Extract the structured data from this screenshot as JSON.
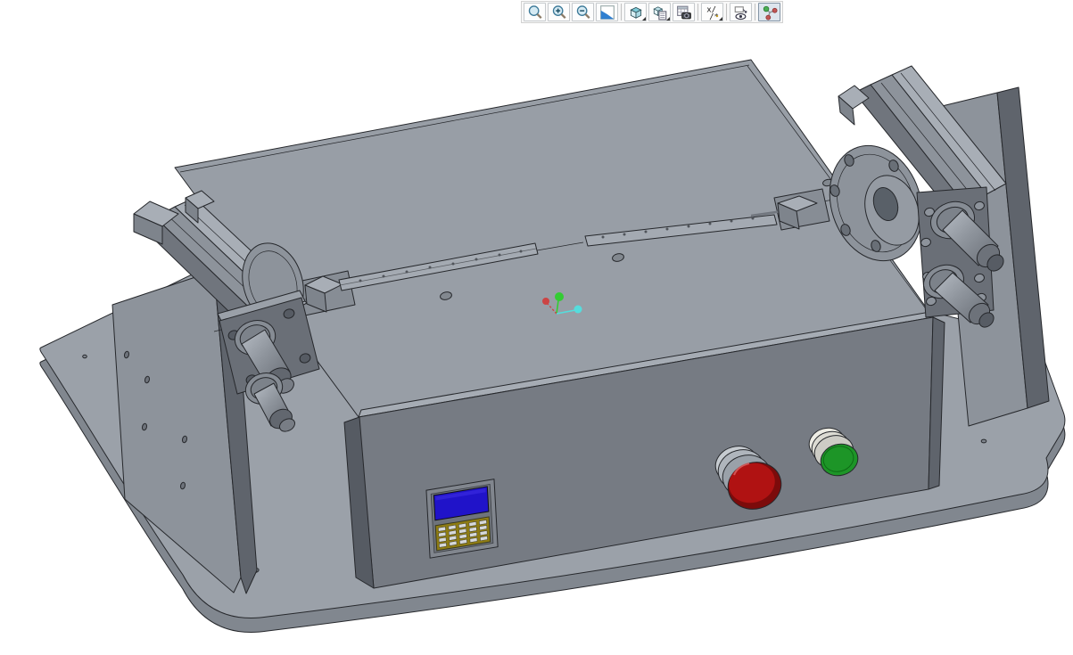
{
  "window": {
    "type": "cad-application-viewport",
    "background": "#ffffff"
  },
  "toolbar": {
    "position": "top-center",
    "buttons": [
      {
        "name": "refit",
        "icon": "magnifier-icon",
        "active": false,
        "dropdown": false,
        "group_end": false
      },
      {
        "name": "zoom-in",
        "icon": "magnifier-plus-icon",
        "active": false,
        "dropdown": false,
        "group_end": false
      },
      {
        "name": "zoom-out",
        "icon": "magnifier-minus-icon",
        "active": false,
        "dropdown": false,
        "group_end": false
      },
      {
        "name": "repaint",
        "icon": "repaint-icon",
        "active": false,
        "dropdown": false,
        "group_end": true
      },
      {
        "name": "display-style",
        "icon": "cube-icon",
        "active": false,
        "dropdown": true,
        "group_end": false
      },
      {
        "name": "saved-orientations",
        "icon": "cube-page-icon",
        "active": false,
        "dropdown": true,
        "group_end": false
      },
      {
        "name": "capture-image",
        "icon": "table-camera-icon",
        "active": false,
        "dropdown": false,
        "group_end": true
      },
      {
        "name": "datum-display-filters",
        "icon": "datum-filters-icon",
        "active": false,
        "dropdown": true,
        "group_end": true
      },
      {
        "name": "annotation-display",
        "icon": "annotation-eye-icon",
        "active": false,
        "dropdown": false,
        "group_end": true
      },
      {
        "name": "spin-center",
        "icon": "spin-center-icon",
        "active": true,
        "dropdown": false,
        "group_end": false
      }
    ]
  },
  "viewport": {
    "content": "3D CAD assembly - clamping fixture on rounded base plate",
    "spin_center": {
      "visible": true,
      "axis_colors": {
        "vertical": "#33cc33",
        "left": "#cc4444",
        "right": "#55dddd"
      }
    },
    "model_parts": [
      "base-plate",
      "left-upright-plate",
      "right-upright-plate",
      "left-clamp-unit",
      "right-clamp-unit",
      "rotary-flange",
      "main-housing",
      "top-guide-rails",
      "control-panel",
      "lcd-display",
      "keypad",
      "red-emergency-button",
      "green-start-button"
    ]
  },
  "theme": {
    "canvas_bg": "#ffffff",
    "edge": "#26282c",
    "metal_top": "#989ea6",
    "metal_front": "#767b83",
    "metal_side": "#5f646c",
    "red_button": "#b01212",
    "red_button_rim": "#7c0b0b",
    "green_button": "#1d9527",
    "lcd_blue": "#2013c9",
    "keypad_gold": "#8e7c14",
    "axis_green": "#33cc33",
    "axis_red": "#cc4444",
    "axis_cyan": "#55dddd"
  }
}
